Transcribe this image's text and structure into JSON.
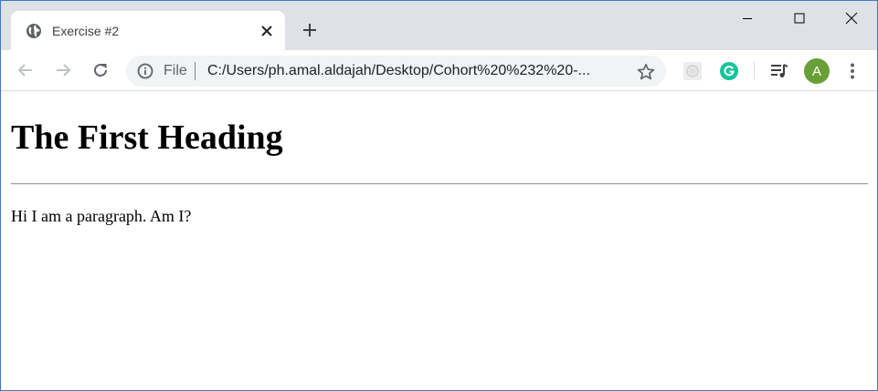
{
  "browser": {
    "tab": {
      "title": "Exercise #2",
      "favicon": "globe-icon"
    },
    "address_bar": {
      "scheme_label": "File",
      "url": "C:/Users/ph.amal.aldajah/Desktop/Cohort%20%232%20-..."
    },
    "profile_initial": "A",
    "colors": {
      "tabstrip": "#dee1e6",
      "avatar": "#689f38",
      "grammarly": "#15c39a"
    },
    "icons": [
      "globe-icon",
      "close-icon",
      "plus-icon",
      "minimize-icon",
      "maximize-icon",
      "close-window-icon",
      "back-arrow-icon",
      "forward-arrow-icon",
      "reload-icon",
      "info-icon",
      "star-icon",
      "extension-icon",
      "grammarly-icon",
      "media-queue-icon",
      "more-vert-icon"
    ]
  },
  "page": {
    "heading": "The First Heading",
    "paragraph": "Hi I am a paragraph. Am I?"
  }
}
